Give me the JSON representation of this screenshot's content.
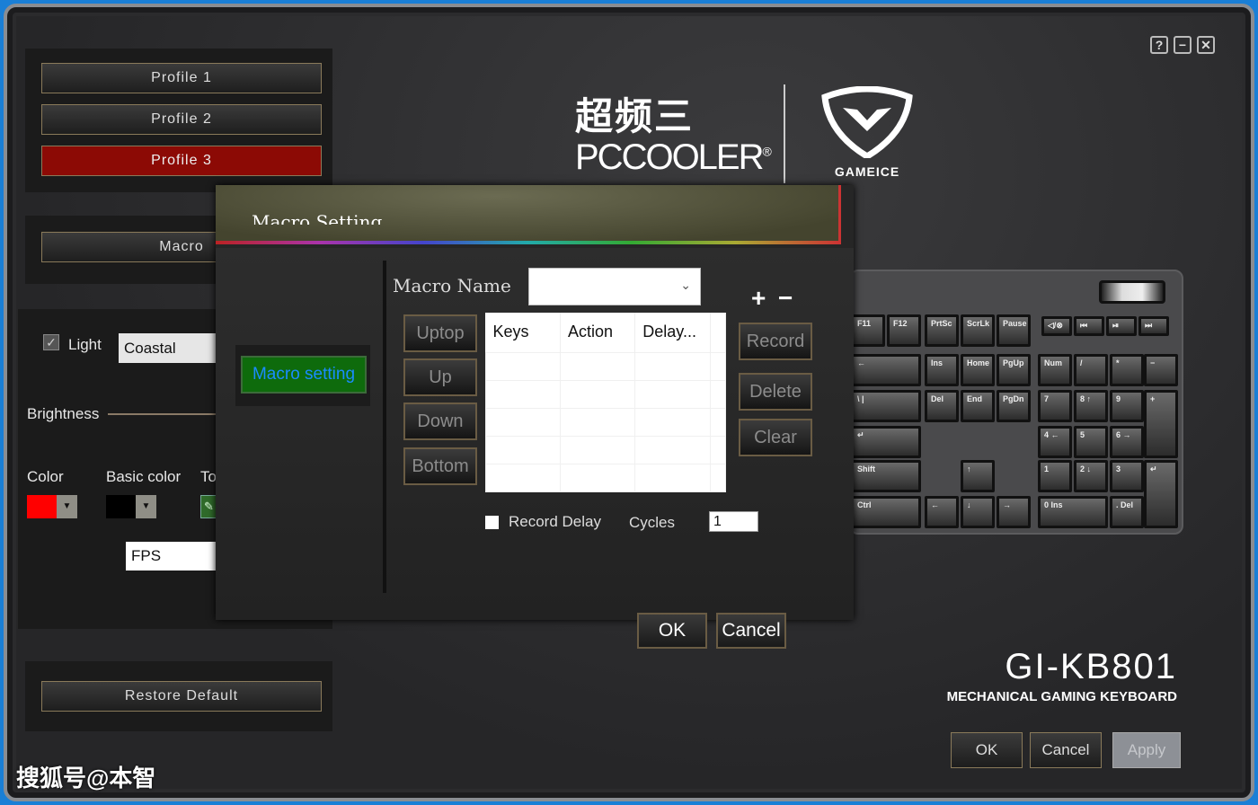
{
  "window_controls": {
    "help": "?",
    "minimize": "−",
    "close": "✕"
  },
  "profiles": [
    {
      "label": "Profile 1",
      "active": false
    },
    {
      "label": "Profile 2",
      "active": false
    },
    {
      "label": "Profile 3",
      "active": true
    }
  ],
  "macro_button": "Macro",
  "lighting": {
    "light_label": "Light",
    "light_checked": true,
    "effect_value": "Coastal",
    "brightness_label": "Brightness",
    "color_label": "Color",
    "color_value": "#ff0000",
    "basic_color_label": "Basic color",
    "basic_color_value": "#000000",
    "third_label_partial": "To",
    "mode_value": "FPS"
  },
  "restore_default": "Restore Default",
  "brand": {
    "cn": "超频三",
    "en": "PCCOOLER",
    "reg": "®",
    "gameice": "GAMEICE"
  },
  "model": {
    "name": "GI-KB801",
    "subtitle": "MECHANICAL GAMING KEYBOARD"
  },
  "footer": {
    "ok": "OK",
    "cancel": "Cancel",
    "apply": "Apply"
  },
  "keyboard_keys": [
    "F11",
    "F12",
    "PrtSc",
    "ScrLk",
    "Pause",
    "◁/⊗",
    "⏮",
    "⏯",
    "⏭",
    "←",
    "Ins",
    "Home",
    "PgUp",
    "Num",
    "/",
    "*",
    "−",
    "\\ |",
    "Del",
    "End",
    "PgDn",
    "7",
    "8 ↑",
    "9",
    "+",
    "↵",
    "4 ←",
    "5",
    "6 →",
    "Shift",
    "↑",
    "1",
    "2 ↓",
    "3",
    "↵",
    "Ctrl",
    "←",
    "↓",
    "→",
    "0 Ins",
    ". Del"
  ],
  "dialog": {
    "title": "Macro Setting",
    "sidebar_tab": "Macro setting",
    "macro_name_label": "Macro Name",
    "macro_name_value": "",
    "add": "+",
    "remove": "−",
    "move_buttons": [
      "Uptop",
      "Up",
      "Down",
      "Bottom"
    ],
    "columns": [
      "Keys",
      "Action",
      "Delay..."
    ],
    "rows": [],
    "action_buttons": [
      "Record",
      "Delete",
      "Clear"
    ],
    "record_delay_label": "Record Delay",
    "record_delay_checked": false,
    "cycles_label": "Cycles",
    "cycles_value": "1",
    "ok": "OK",
    "cancel": "Cancel"
  },
  "watermark": "搜狐号@本智"
}
